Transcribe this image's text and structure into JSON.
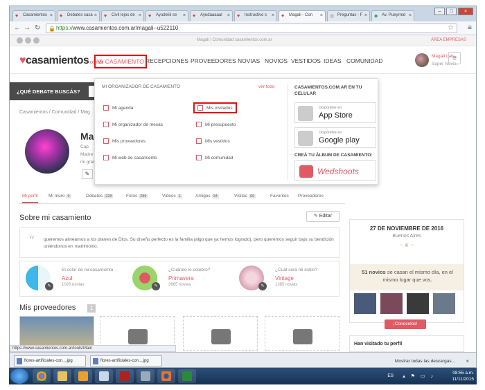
{
  "browser": {
    "tabs": [
      {
        "label": "Casamientos"
      },
      {
        "label": "Debates casa"
      },
      {
        "label": "Civil lejos de"
      },
      {
        "label": "Ayudeliii se"
      },
      {
        "label": "Ayudaaaaal"
      },
      {
        "label": "Instructivo s"
      },
      {
        "label": "Magali - Con"
      },
      {
        "label": "Preguntas - F"
      },
      {
        "label": "Av. Pueyrred"
      }
    ],
    "url_scheme": "https://",
    "url_rest": "www.casamientos.com.ar/magali--u522110"
  },
  "site": {
    "topbar_center": "Magali | Comunidad casamientos.com.ar",
    "area_empresas": "ÁREA EMPRESAS",
    "logo_text": "casamientos",
    "logo_domain": ".com.ar",
    "nav": [
      "MI CASAMIENTO",
      "RECEPCIONES",
      "PROVEEDORES",
      "NOVIAS",
      "NOVIOS",
      "VESTIDOS",
      "IDEAS",
      "COMUNIDAD"
    ],
    "user_name": "Magali Lab...",
    "user_role": "Super Novia",
    "debate_question": "¿QUÉ DEBATE BUSCÁS?",
    "breadcrumb": "Casamientos  /  Comunidad  /  Mag"
  },
  "dropdown": {
    "header": "MI ORGANIZADOR DE CASAMIENTO",
    "ver_todo": "ver todo",
    "left_items": [
      "Mi agenda",
      "Mi organizador de mesas",
      "Mis proveedores",
      "Mi web de casamiento"
    ],
    "right_items": [
      "Mis invitados",
      "Mi presupuesto",
      "Mis vestidos",
      "Mi comunidad"
    ],
    "app_heading": "CASAMIENTOS.COM.AR EN TU CELULAR",
    "appstore_small": "Disponible en",
    "appstore_big": "App Store",
    "gplay_small": "Disponible en",
    "gplay_big": "Google play",
    "album_heading": "CREÁ TU ÁLBUM DE CASAMIENTO:",
    "wedshoots": "Wedshoots"
  },
  "profile": {
    "name": "Mag",
    "info_line1": "Cap",
    "info_line2": "Madre",
    "info_line3": "mi grar",
    "tabs": [
      {
        "label": "Mi perfil",
        "count": ""
      },
      {
        "label": "Mi muro",
        "count": "9"
      },
      {
        "label": "Debates",
        "count": "228"
      },
      {
        "label": "Fotos",
        "count": "289"
      },
      {
        "label": "Videos",
        "count": "1"
      },
      {
        "label": "Amigos",
        "count": "34"
      },
      {
        "label": "Visitas",
        "count": "66"
      },
      {
        "label": "Favoritos",
        "count": ""
      },
      {
        "label": "Proveedores",
        "count": ""
      }
    ],
    "about_title": "Sobre mi casamiento",
    "edit_label": "Editar",
    "quote": "queremos alinearnos a los planes de Dios. Su diseño perfecto es la familia (algo que ya hemos logrado), pero queremos seguir bajo su bendición uniéndonos en matrimonio.",
    "facts": [
      {
        "label": "El color de mi casamiento",
        "value": "Azul",
        "count": "1026 novias",
        "color": "#3fb7e8"
      },
      {
        "label": "¿Cuándo lo celebro?",
        "value": "Primavera",
        "count": "3965 novias",
        "color": "#e05a64"
      },
      {
        "label": "¿Cuál será mi estilo?",
        "value": "Vintage",
        "count": "1385 novias",
        "color": "#d8a0b0"
      }
    ],
    "providers_title": "Mis proveedores",
    "providers_count": "1"
  },
  "sidebar": {
    "date": "27 DE NOVIEMBRE DE 2016",
    "city": "Buenos Aires",
    "ornament": "~ ❦ ~",
    "same_day_count": "51 novios",
    "same_day_text": " se casan el mismo día, en el mismo lugar que vos.",
    "button": "¡Conocelos!",
    "visited_title": "Han visitado tu perfil"
  },
  "status": {
    "hover_url": "https://www.casamientos.com.ar/tools/Main",
    "downloads": [
      "flores-artificiales-con....jpg",
      "flores-artificiales-con....jpg"
    ],
    "show_all": "Mostrar todas las descargas..."
  },
  "taskbar": {
    "lang": "ES",
    "time": "08:55 a.m.",
    "date": "11/11/2015"
  }
}
